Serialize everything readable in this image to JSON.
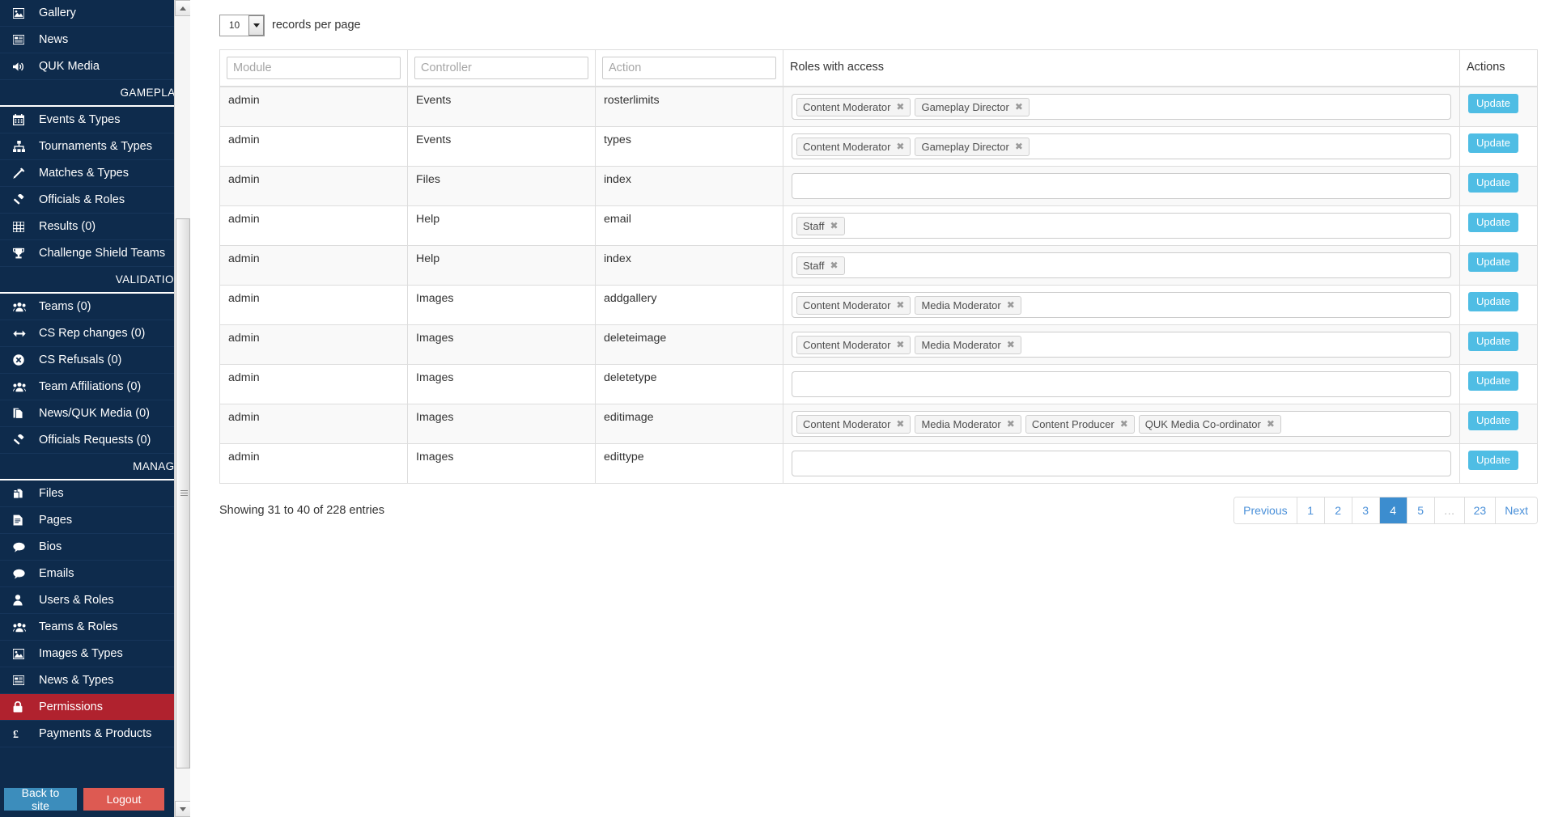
{
  "sidebar": {
    "items": [
      {
        "label": "Gallery",
        "icon": "image-icon",
        "type": "item",
        "active": false
      },
      {
        "label": "News",
        "icon": "news-icon",
        "type": "item",
        "active": false
      },
      {
        "label": "QUK Media",
        "icon": "volume-icon",
        "type": "item",
        "active": false
      },
      {
        "label": "GAMEPLAY",
        "icon": "",
        "type": "header",
        "active": false
      },
      {
        "label": "Events & Types",
        "icon": "calendar-icon",
        "type": "item",
        "active": false
      },
      {
        "label": "Tournaments & Types",
        "icon": "sitemap-icon",
        "type": "item",
        "active": false
      },
      {
        "label": "Matches & Types",
        "icon": "crosshair-icon",
        "type": "item",
        "active": false
      },
      {
        "label": "Officials & Roles",
        "icon": "gavel-icon",
        "type": "item",
        "active": false
      },
      {
        "label": "Results (0)",
        "icon": "table-icon",
        "type": "item",
        "active": false
      },
      {
        "label": "Challenge Shield Teams",
        "icon": "trophy-icon",
        "type": "item",
        "active": false
      },
      {
        "label": "VALIDATION",
        "icon": "",
        "type": "header",
        "active": false
      },
      {
        "label": "Teams (0)",
        "icon": "users-icon",
        "type": "item",
        "active": false
      },
      {
        "label": "CS Rep changes (0)",
        "icon": "arrows-h-icon",
        "type": "item",
        "active": false
      },
      {
        "label": "CS Refusals (0)",
        "icon": "times-circle-icon",
        "type": "item",
        "active": false
      },
      {
        "label": "Team Affiliations (0)",
        "icon": "users-icon",
        "type": "item",
        "active": false
      },
      {
        "label": "News/QUK Media (0)",
        "icon": "file-copy-icon",
        "type": "item",
        "active": false
      },
      {
        "label": "Officials Requests (0)",
        "icon": "gavel-icon",
        "type": "item",
        "active": false
      },
      {
        "label": "MANAGE",
        "icon": "",
        "type": "header",
        "active": false
      },
      {
        "label": "Files",
        "icon": "files-icon",
        "type": "item",
        "active": false
      },
      {
        "label": "Pages",
        "icon": "page-icon",
        "type": "item",
        "active": false
      },
      {
        "label": "Bios",
        "icon": "comment-icon",
        "type": "item",
        "active": false
      },
      {
        "label": "Emails",
        "icon": "comment-icon",
        "type": "item",
        "active": false
      },
      {
        "label": "Users & Roles",
        "icon": "user-icon",
        "type": "item",
        "active": false
      },
      {
        "label": "Teams & Roles",
        "icon": "users-icon",
        "type": "item",
        "active": false
      },
      {
        "label": "Images & Types",
        "icon": "image-icon",
        "type": "item",
        "active": false
      },
      {
        "label": "News & Types",
        "icon": "news-icon",
        "type": "item",
        "active": false
      },
      {
        "label": "Permissions",
        "icon": "lock-icon",
        "type": "item",
        "active": true
      },
      {
        "label": "Payments & Products",
        "icon": "pound-icon",
        "type": "item",
        "active": false
      }
    ],
    "footer": {
      "back_label": "Back to site",
      "logout_label": "Logout"
    },
    "colors": {
      "background": "#0e2b4c",
      "active": "#b0222e",
      "back_button": "#3c8dbc",
      "logout_button": "#dd5a52"
    }
  },
  "toolbar": {
    "page_length_value": "10",
    "page_length_label": "records per page"
  },
  "table": {
    "headers": {
      "module_placeholder": "Module",
      "controller_placeholder": "Controller",
      "action_placeholder": "Action",
      "roles": "Roles with access",
      "actions": "Actions"
    },
    "filters": {
      "module_value": "",
      "controller_value": "",
      "action_value": ""
    },
    "update_label": "Update",
    "rows": [
      {
        "module": "admin",
        "controller": "Events",
        "action": "rosterlimits",
        "roles": [
          "Content Moderator",
          "Gameplay Director"
        ]
      },
      {
        "module": "admin",
        "controller": "Events",
        "action": "types",
        "roles": [
          "Content Moderator",
          "Gameplay Director"
        ]
      },
      {
        "module": "admin",
        "controller": "Files",
        "action": "index",
        "roles": []
      },
      {
        "module": "admin",
        "controller": "Help",
        "action": "email",
        "roles": [
          "Staff"
        ]
      },
      {
        "module": "admin",
        "controller": "Help",
        "action": "index",
        "roles": [
          "Staff"
        ]
      },
      {
        "module": "admin",
        "controller": "Images",
        "action": "addgallery",
        "roles": [
          "Content Moderator",
          "Media Moderator"
        ]
      },
      {
        "module": "admin",
        "controller": "Images",
        "action": "deleteimage",
        "roles": [
          "Content Moderator",
          "Media Moderator"
        ]
      },
      {
        "module": "admin",
        "controller": "Images",
        "action": "deletetype",
        "roles": []
      },
      {
        "module": "admin",
        "controller": "Images",
        "action": "editimage",
        "roles": [
          "Content Moderator",
          "Media Moderator",
          "Content Producer",
          "QUK Media Co-ordinator"
        ]
      },
      {
        "module": "admin",
        "controller": "Images",
        "action": "edittype",
        "roles": []
      }
    ]
  },
  "footer": {
    "showing": "Showing 31 to 40 of 228 entries",
    "pagination": {
      "previous": "Previous",
      "next": "Next",
      "pages": [
        "1",
        "2",
        "3",
        "4",
        "5",
        "…",
        "23"
      ],
      "current": "4"
    }
  }
}
